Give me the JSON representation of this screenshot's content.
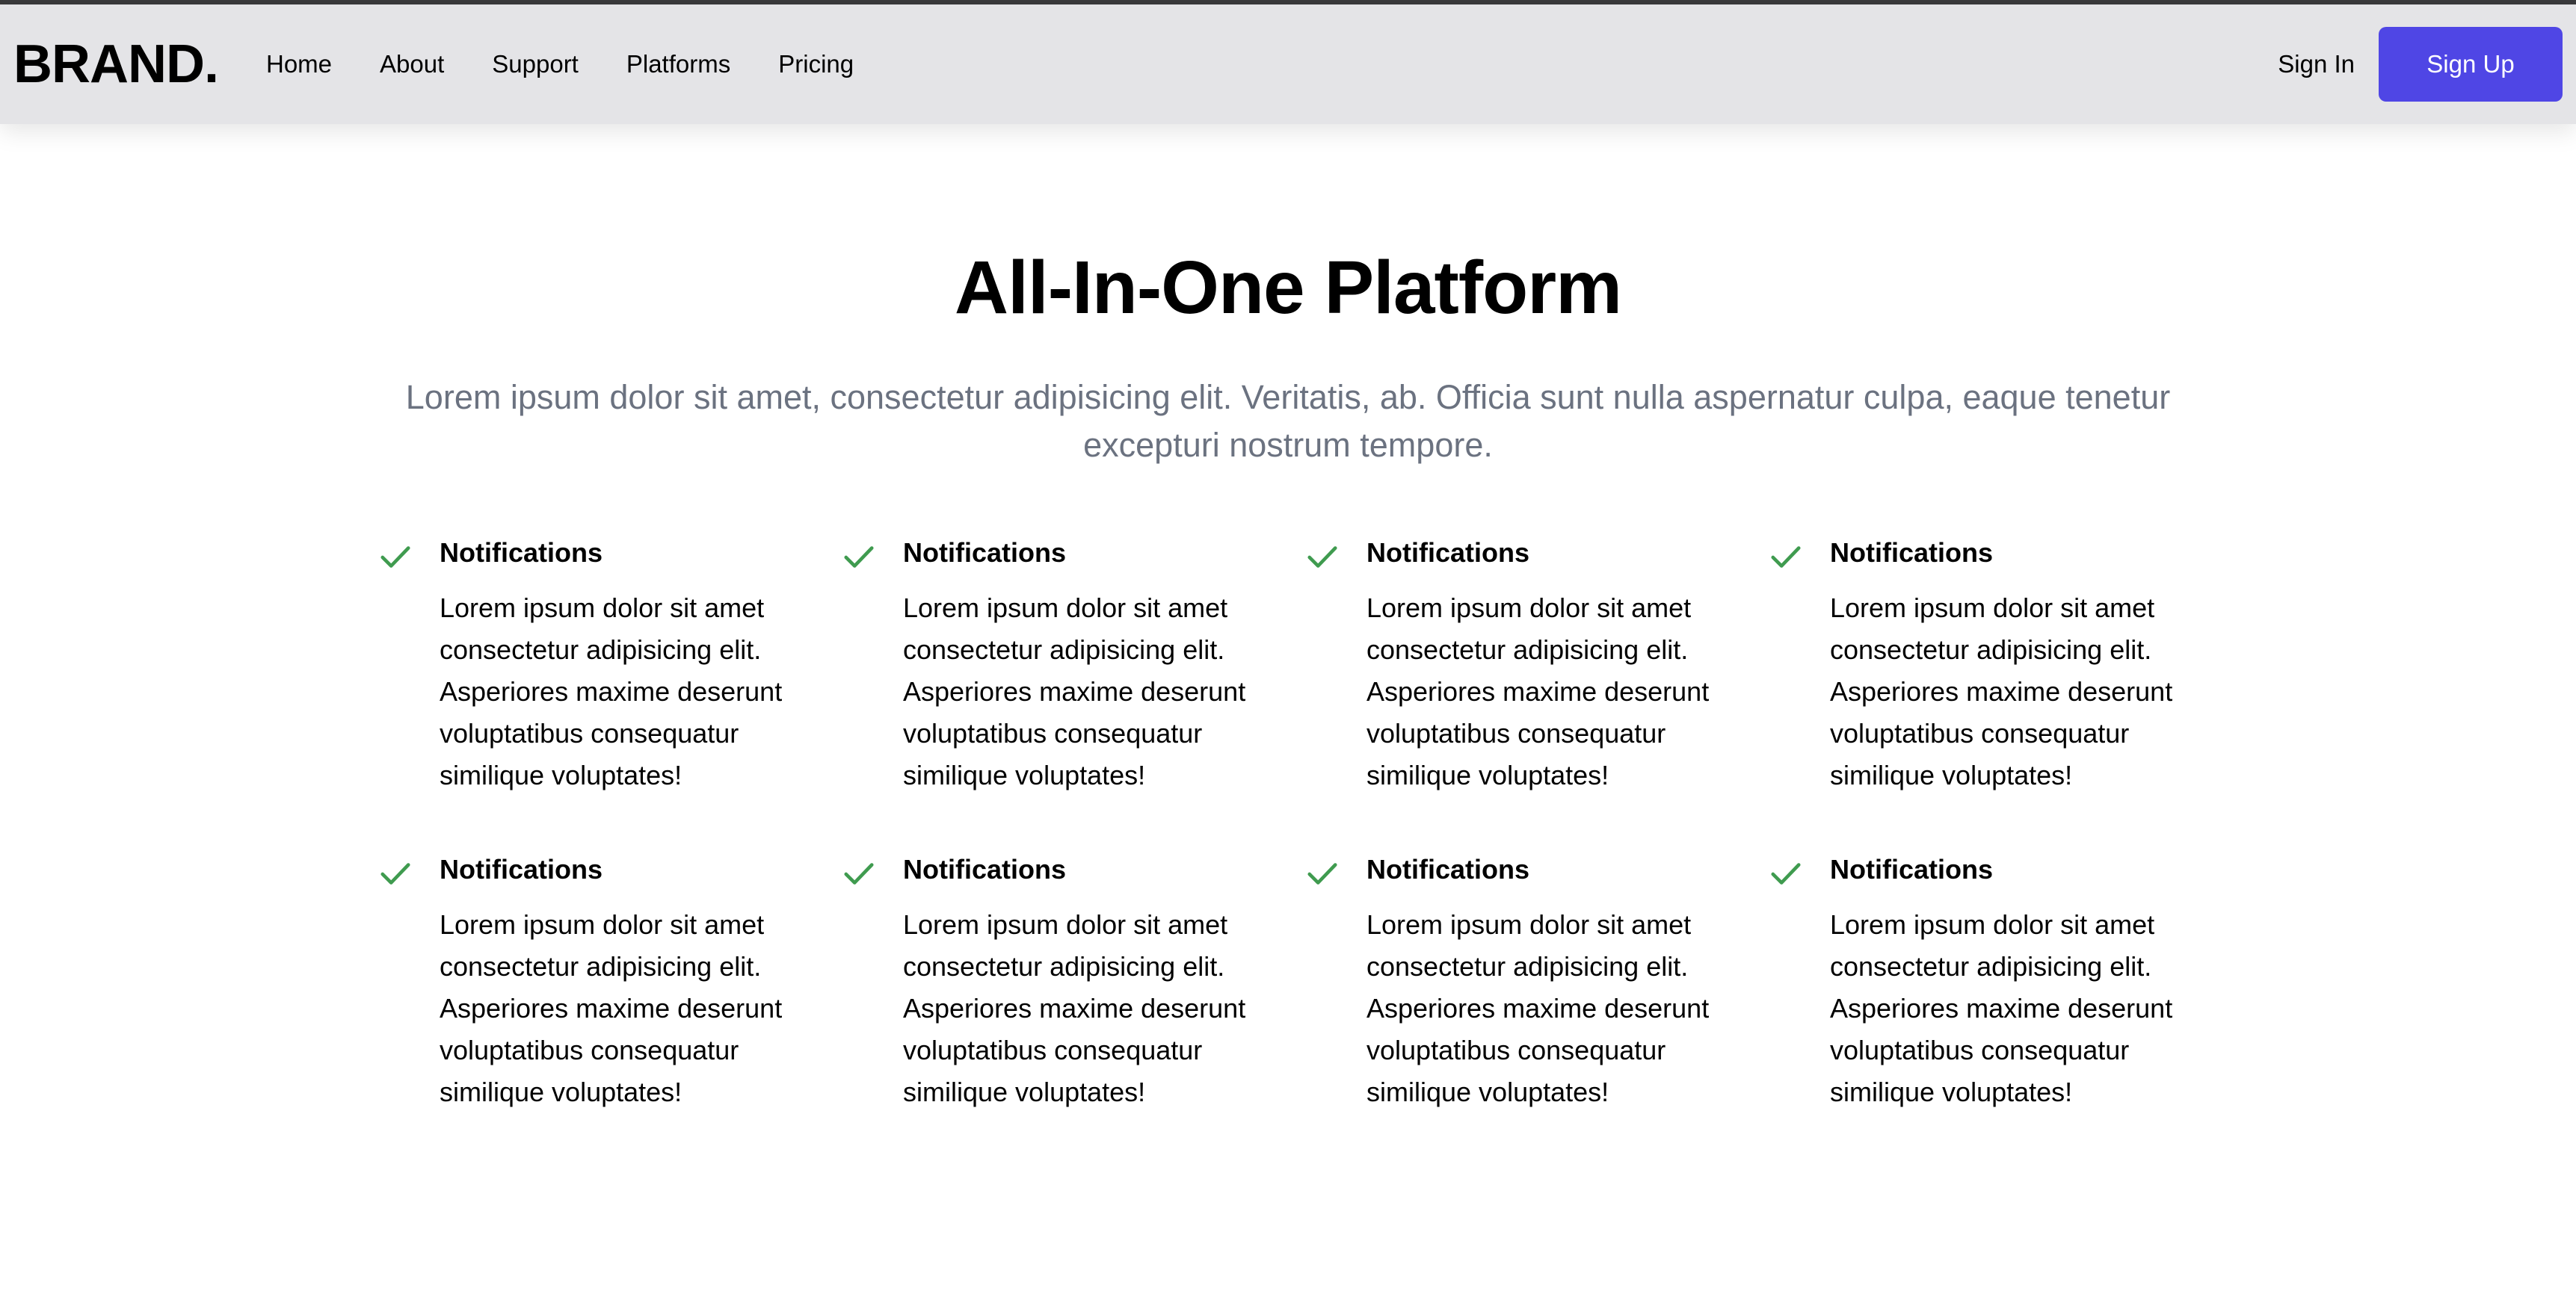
{
  "navbar": {
    "brand": "BRAND.",
    "links": [
      {
        "label": "Home"
      },
      {
        "label": "About"
      },
      {
        "label": "Support"
      },
      {
        "label": "Platforms"
      },
      {
        "label": "Pricing"
      }
    ],
    "sign_in": "Sign In",
    "sign_up": "Sign Up",
    "accent_color": "#4f46e5"
  },
  "hero": {
    "title": "All-In-One Platform",
    "subtitle": "Lorem ipsum dolor sit amet, consectetur adipisicing elit. Veritatis, ab. Officia sunt nulla aspernatur culpa, eaque tenetur excepturi nostrum tempore."
  },
  "features": {
    "icon": "check-icon",
    "icon_color": "#3f9b4f",
    "items": [
      {
        "title": "Notifications",
        "text": "Lorem ipsum dolor sit amet consectetur adipisicing elit. Asperiores maxime deserunt voluptatibus consequatur similique voluptates!"
      },
      {
        "title": "Notifications",
        "text": "Lorem ipsum dolor sit amet consectetur adipisicing elit. Asperiores maxime deserunt voluptatibus consequatur similique voluptates!"
      },
      {
        "title": "Notifications",
        "text": "Lorem ipsum dolor sit amet consectetur adipisicing elit. Asperiores maxime deserunt voluptatibus consequatur similique voluptates!"
      },
      {
        "title": "Notifications",
        "text": "Lorem ipsum dolor sit amet consectetur adipisicing elit. Asperiores maxime deserunt voluptatibus consequatur similique voluptates!"
      },
      {
        "title": "Notifications",
        "text": "Lorem ipsum dolor sit amet consectetur adipisicing elit. Asperiores maxime deserunt voluptatibus consequatur similique voluptates!"
      },
      {
        "title": "Notifications",
        "text": "Lorem ipsum dolor sit amet consectetur adipisicing elit. Asperiores maxime deserunt voluptatibus consequatur similique voluptates!"
      },
      {
        "title": "Notifications",
        "text": "Lorem ipsum dolor sit amet consectetur adipisicing elit. Asperiores maxime deserunt voluptatibus consequatur similique voluptates!"
      },
      {
        "title": "Notifications",
        "text": "Lorem ipsum dolor sit amet consectetur adipisicing elit. Asperiores maxime deserunt voluptatibus consequatur similique voluptates!"
      }
    ]
  }
}
